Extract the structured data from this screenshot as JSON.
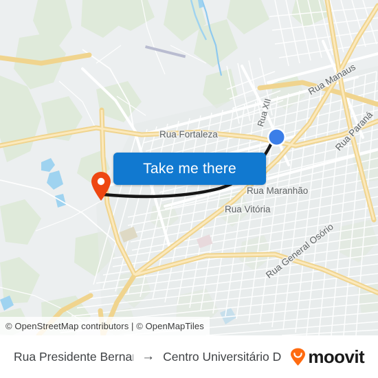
{
  "map": {
    "attribution": "© OpenStreetMap contributors | © OpenMapTiles",
    "cta_label": "Take me there",
    "colors": {
      "cta_blue": "#1179d0",
      "origin_marker": "#ee4711",
      "destination_dot": "#3b7ee8",
      "route_line": "#161616",
      "arterial_road": "#f6dd9b",
      "land": "#eceff0",
      "park": "#cfe5c6",
      "water": "#9fd3f0",
      "moovit_orange": "#ff6b10"
    },
    "street_labels": [
      {
        "id": "fortaleza",
        "text": "Rua Fortaleza"
      },
      {
        "id": "manaus",
        "text": "Rua Manaus"
      },
      {
        "id": "parana",
        "text": "Rua Paraná"
      },
      {
        "id": "maranhao",
        "text": "Rua Maranhão"
      },
      {
        "id": "vitoria",
        "text": "Rua Vitória"
      },
      {
        "id": "osorio",
        "text": "Rua General Osório"
      },
      {
        "id": "xii",
        "text": "Rua XII"
      }
    ]
  },
  "footer": {
    "origin": "Rua Presidente Bernard…",
    "arrow": "→",
    "destination": "Centro Universitário De …",
    "brand": "moovit"
  }
}
